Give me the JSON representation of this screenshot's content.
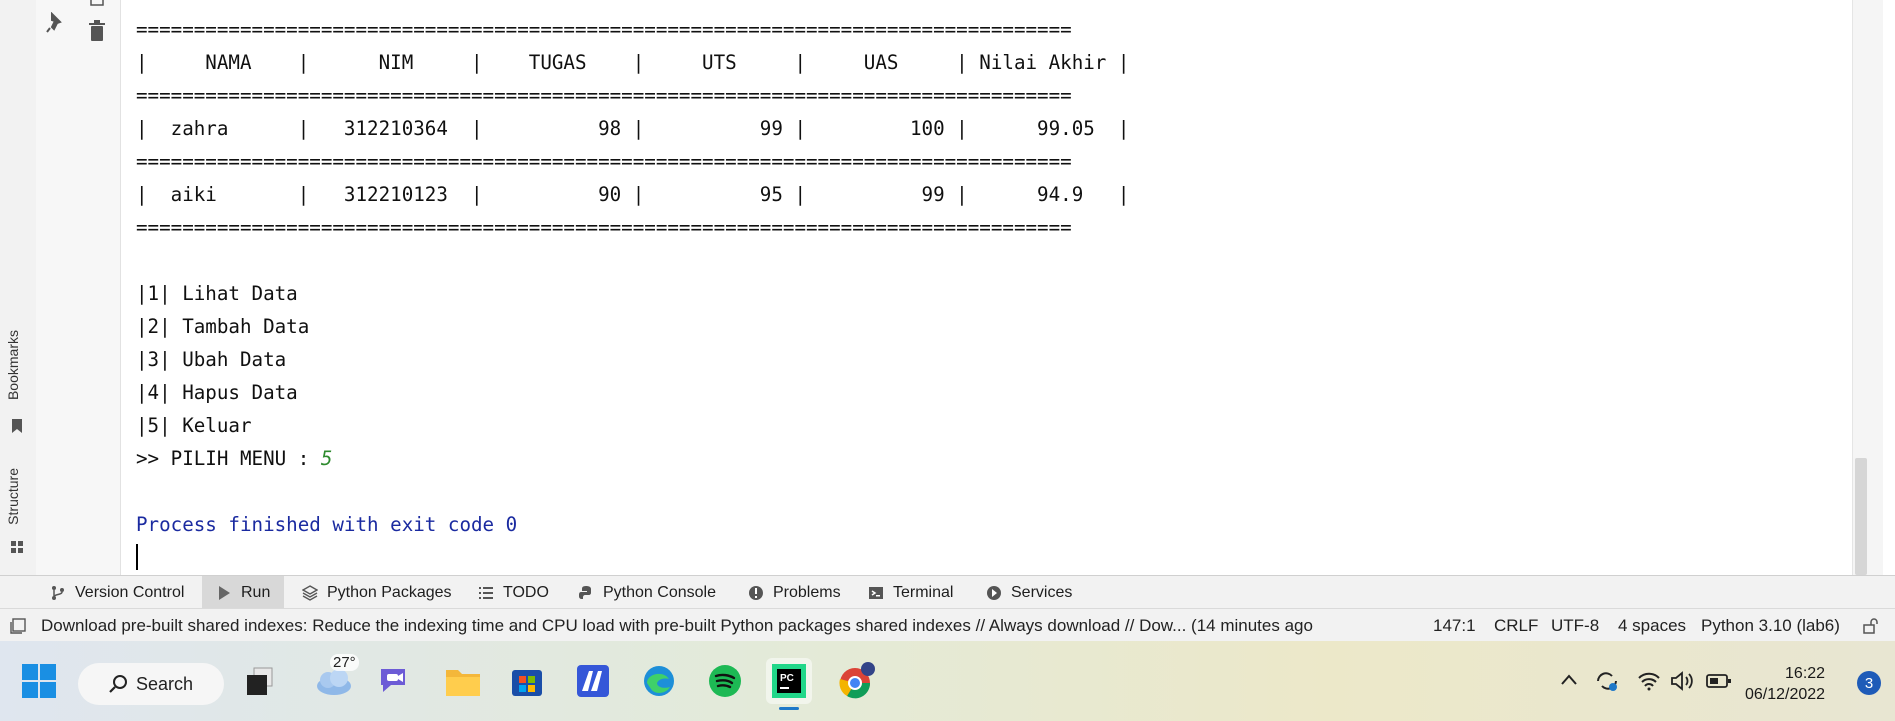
{
  "sidebar": {
    "bookmarks_label": "Bookmarks",
    "structure_label": "Structure"
  },
  "console": {
    "lines": [
      "=================================================================================",
      "|     NAMA    |      NIM     |    TUGAS    |     UTS     |     UAS     | Nilai Akhir |",
      "=================================================================================",
      "|  zahra      |   312210364  |          98 |          99 |         100 |      99.05  |",
      "=================================================================================",
      "|  aiki       |   312210123  |          90 |          95 |          99 |      94.9   |",
      "=================================================================================",
      "|1| Lihat Data",
      "|2| Tambah Data",
      "|3| Ubah Data",
      "|4| Hapus Data",
      "|5| Keluar"
    ],
    "prompt_label": ">> PILIH MENU : ",
    "prompt_value": "5",
    "process_message": "Process finished with exit code 0"
  },
  "tool_tabs": [
    {
      "label": "Version Control",
      "icon": "branch-icon"
    },
    {
      "label": "Run",
      "icon": "run-icon",
      "active": true
    },
    {
      "label": "Python Packages",
      "icon": "packages-icon"
    },
    {
      "label": "TODO",
      "icon": "list-icon"
    },
    {
      "label": "Python Console",
      "icon": "python-icon"
    },
    {
      "label": "Problems",
      "icon": "problems-icon"
    },
    {
      "label": "Terminal",
      "icon": "terminal-icon"
    },
    {
      "label": "Services",
      "icon": "services-icon"
    }
  ],
  "status_bar": {
    "message": "Download pre-built shared indexes: Reduce the indexing time and CPU load with pre-built Python packages shared indexes // Always download // Dow... (14 minutes ago",
    "position": "147:1",
    "line_ending": "CRLF",
    "encoding": "UTF-8",
    "indent": "4 spaces",
    "interpreter": "Python 3.10 (lab6)"
  },
  "taskbar": {
    "search_label": "Search",
    "weather_temp": "27°",
    "time": "16:22",
    "date": "06/12/2022",
    "notification_count": "3"
  },
  "colors": {
    "accent_blue": "#1a2aa0",
    "input_green": "#2d8a2d"
  }
}
